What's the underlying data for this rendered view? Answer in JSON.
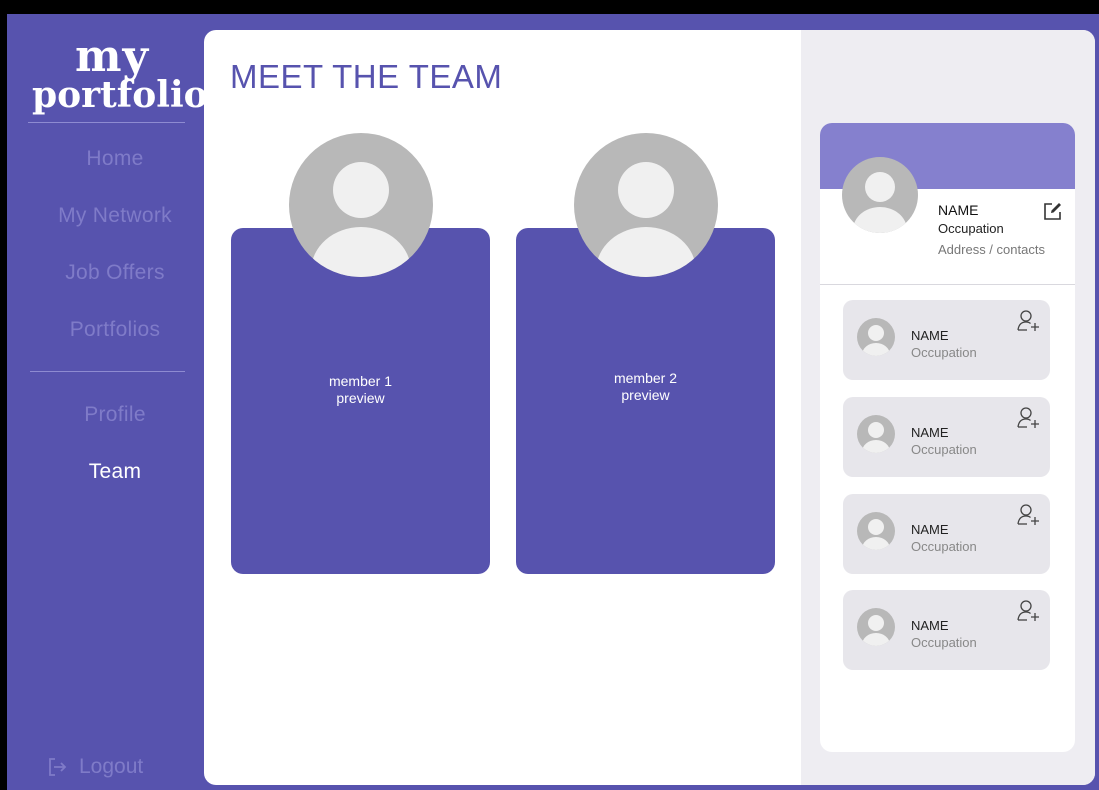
{
  "app": {
    "logo_line1": "my",
    "logo_line2": "portfolio"
  },
  "sidebar": {
    "items": [
      {
        "label": "Home"
      },
      {
        "label": "My Network"
      },
      {
        "label": "Job Offers"
      },
      {
        "label": "Portfolios"
      },
      {
        "label": "Profile"
      },
      {
        "label": "Team",
        "active": true
      }
    ],
    "logout_label": "Logout"
  },
  "main": {
    "title": "MEET THE TEAM",
    "members": [
      {
        "label_line1": "member 1",
        "label_line2": "preview"
      },
      {
        "label_line1": "member 2",
        "label_line2": "preview"
      }
    ]
  },
  "profile": {
    "name": "NAME",
    "occupation": "Occupation",
    "address": "Address / contacts",
    "suggestions": [
      {
        "name": "NAME",
        "occupation": "Occupation"
      },
      {
        "name": "NAME",
        "occupation": "Occupation"
      },
      {
        "name": "NAME",
        "occupation": "Occupation"
      },
      {
        "name": "NAME",
        "occupation": "Occupation"
      }
    ]
  },
  "colors": {
    "brand": "#5753AE",
    "banner": "#8580CE",
    "panel": "#EEEDF2",
    "avatar_gray": "#B8B8B8"
  }
}
